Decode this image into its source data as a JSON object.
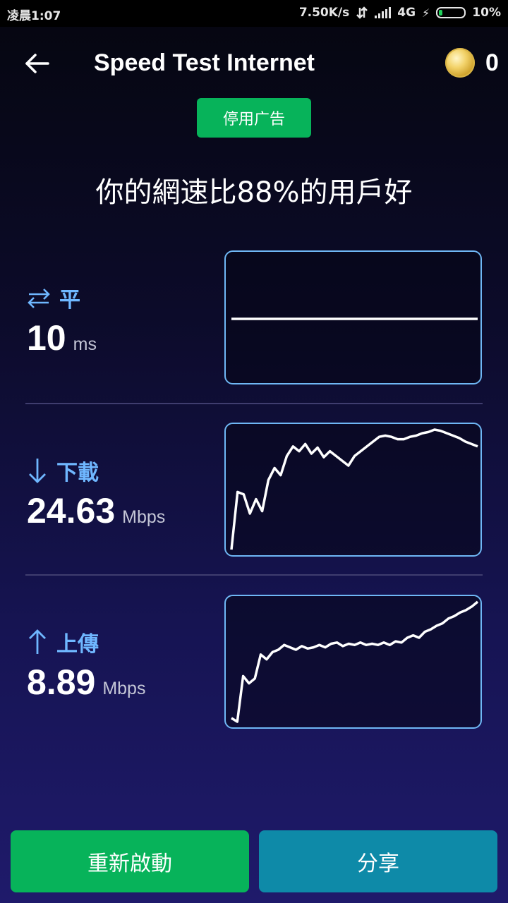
{
  "status_bar": {
    "time": "凌晨1:07",
    "net_speed": "7.50K/s",
    "network_type": "4G",
    "battery": "10%",
    "icons": [
      "data-transfer-icon",
      "signal-icon",
      "charging-bolt-icon",
      "battery-icon"
    ]
  },
  "header": {
    "title": "Speed Test Internet",
    "coin_count": "0",
    "back_icon": "arrow-left-icon",
    "coin_icon": "gold-coin-icon"
  },
  "ads": {
    "disable_label": "停用广告"
  },
  "summary": {
    "text": "你的網速比88%的用戶好"
  },
  "metrics": {
    "ping": {
      "label": "平",
      "value": "10",
      "unit": "ms",
      "icon": "swap-arrows-icon"
    },
    "download": {
      "label": "下載",
      "value": "24.63",
      "unit": "Mbps",
      "icon": "arrow-down-icon"
    },
    "upload": {
      "label": "上傳",
      "value": "8.89",
      "unit": "Mbps",
      "icon": "arrow-up-icon"
    }
  },
  "graphs": {
    "ping_trace": [
      0.5,
      0.5,
      0.5,
      0.5,
      0.5,
      0.5,
      0.5,
      0.5,
      0.5,
      0.5
    ],
    "download_trace": [
      0.0,
      0.48,
      0.46,
      0.3,
      0.42,
      0.32,
      0.58,
      0.68,
      0.62,
      0.78,
      0.86,
      0.82,
      0.88,
      0.8,
      0.85,
      0.77,
      0.82,
      0.78,
      0.74,
      0.7,
      0.78,
      0.82,
      0.86,
      0.9,
      0.94,
      0.95,
      0.94,
      0.92,
      0.92,
      0.94,
      0.95,
      0.97,
      0.98,
      1.0,
      0.99,
      0.97,
      0.95,
      0.93,
      0.9,
      0.88,
      0.86
    ],
    "upload_trace": [
      0.03,
      0.0,
      0.38,
      0.32,
      0.36,
      0.56,
      0.52,
      0.58,
      0.6,
      0.64,
      0.62,
      0.6,
      0.63,
      0.61,
      0.62,
      0.64,
      0.62,
      0.65,
      0.66,
      0.63,
      0.65,
      0.64,
      0.66,
      0.64,
      0.65,
      0.64,
      0.66,
      0.64,
      0.67,
      0.66,
      0.7,
      0.72,
      0.7,
      0.75,
      0.77,
      0.8,
      0.82,
      0.86,
      0.88,
      0.91,
      0.93,
      0.96,
      1.0
    ]
  },
  "actions": {
    "restart_label": "重新啟動",
    "share_label": "分享"
  },
  "colors": {
    "accent_green": "#07b35a",
    "accent_teal": "#0e8aa8",
    "label_blue": "#6fb7ff",
    "graph_border": "#6fb7f5"
  }
}
